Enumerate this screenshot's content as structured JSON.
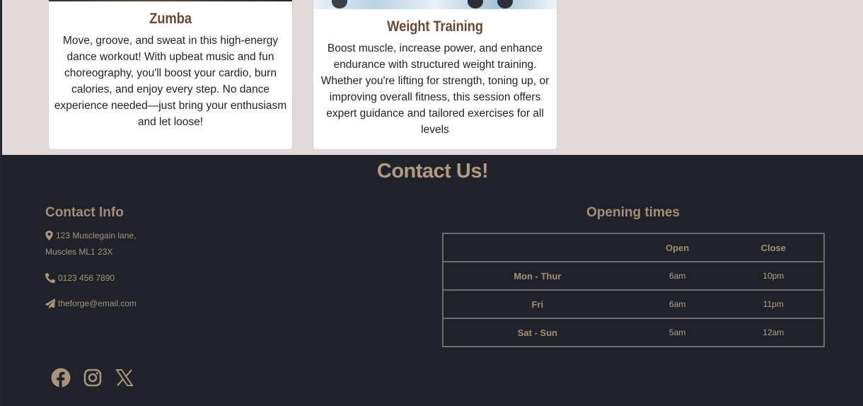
{
  "classes": [
    {
      "title": "Zumba",
      "description": "Move, groove, and sweat in this high-energy dance workout! With upbeat music and fun choreography, you'll boost your cardio, burn calories, and enjoy every step. No dance experience needed—just bring your enthusiasm and let loose!"
    },
    {
      "title": "Weight Training",
      "description": "Boost muscle, increase power, and enhance endurance with structured weight training. Whether you're lifting for strength, toning up, or improving overall fitness, this session offers expert guidance and tailored exercises for all levels"
    }
  ],
  "contact": {
    "heading": "Contact Us!",
    "info_heading": "Contact Info",
    "address_line1": "123 Musclegain lane,",
    "address_line2": "Muscles ML1 23X",
    "phone": "0123 456 7890",
    "email": "theforge@email.com",
    "icons": [
      "map-marker-icon",
      "phone-icon",
      "paper-plane-icon"
    ]
  },
  "social": {
    "icons": [
      "facebook-icon",
      "instagram-icon",
      "x-icon"
    ]
  },
  "hours": {
    "heading": "Opening times",
    "columns": [
      "",
      "Open",
      "Close"
    ],
    "rows": [
      {
        "day": "Mon - Thur",
        "open": "6am",
        "close": "10pm"
      },
      {
        "day": "Fri",
        "open": "6am",
        "close": "11pm"
      },
      {
        "day": "Sat - Sun",
        "open": "5am",
        "close": "12am"
      }
    ]
  },
  "colors": {
    "page_bg": "#e2d9da",
    "footer_bg": "#1f2229",
    "accent_brown": "#6b4a33",
    "footer_text": "#a48e76"
  }
}
